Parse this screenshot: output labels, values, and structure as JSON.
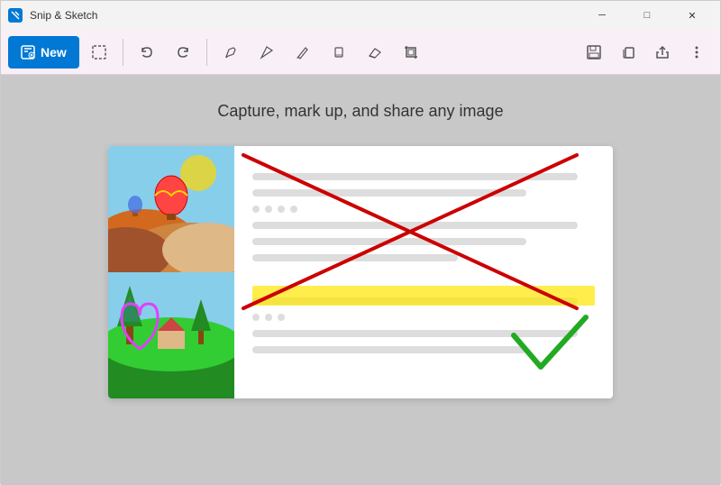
{
  "app": {
    "title": "Snip & Sketch",
    "icon": "scissors-icon"
  },
  "titlebar": {
    "minimize_label": "─",
    "maximize_label": "□",
    "close_label": "✕"
  },
  "toolbar": {
    "new_button_label": "New",
    "undo_icon": "undo-icon",
    "redo_icon": "redo-icon",
    "tools": [
      {
        "name": "ballpoint-pen-icon",
        "symbol": "✒"
      },
      {
        "name": "calligraphy-pen-icon",
        "symbol": "∇"
      },
      {
        "name": "pencil-icon",
        "symbol": "▽"
      },
      {
        "name": "highlighter-icon",
        "symbol": "♦"
      },
      {
        "name": "eraser-icon",
        "symbol": "◻"
      },
      {
        "name": "crop-icon",
        "symbol": "⊡"
      }
    ],
    "save_icon": "save-icon",
    "copy_icon": "copy-icon",
    "share_icon": "share-icon",
    "more_icon": "more-icon"
  },
  "main": {
    "tagline": "Capture, mark up, and share any image"
  },
  "colors": {
    "new_button": "#0078d4",
    "toolbar_bg": "#f9f0f7",
    "main_bg": "#c8c8c8",
    "red_annotation": "#cc0000",
    "yellow_highlight": "rgba(255,230,0,0.7)",
    "green_check": "#22aa22",
    "pink_heart": "#e040fb"
  }
}
